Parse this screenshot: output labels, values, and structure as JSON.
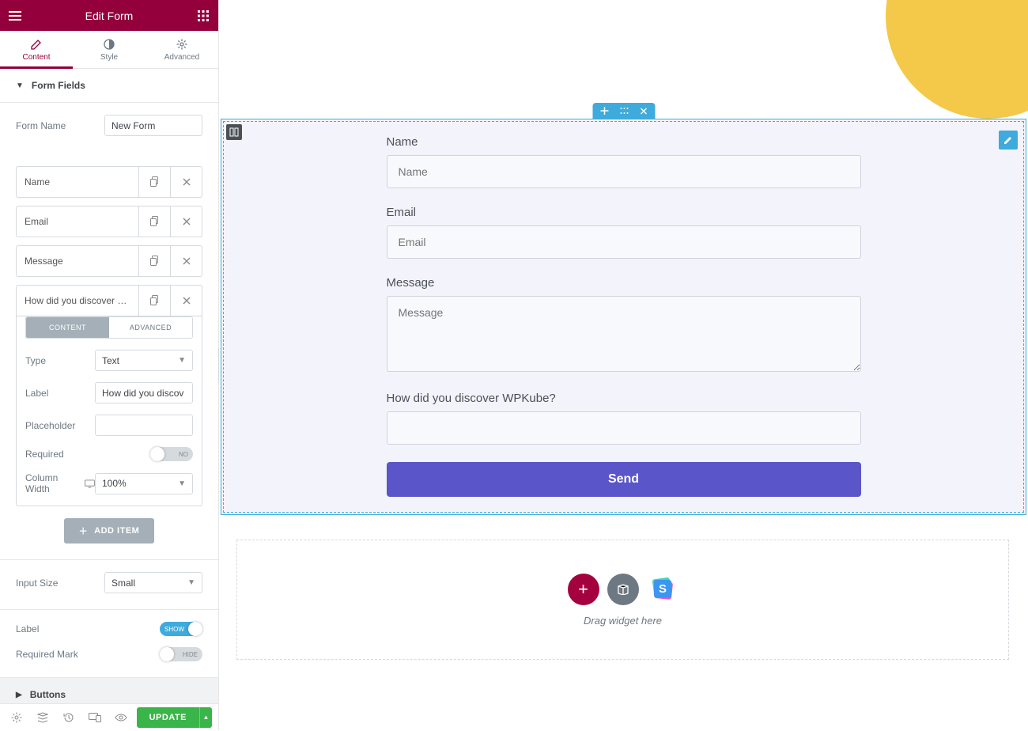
{
  "header": {
    "title": "Edit Form"
  },
  "tabs": {
    "content": "Content",
    "style": "Style",
    "advanced": "Advanced"
  },
  "sections": {
    "form_fields": "Form Fields",
    "buttons": "Buttons"
  },
  "form_name": {
    "label": "Form Name",
    "value": "New Form"
  },
  "fields": {
    "items": [
      {
        "label": "Name"
      },
      {
        "label": "Email"
      },
      {
        "label": "Message"
      },
      {
        "label": "How did you discover W…"
      }
    ],
    "subtabs": {
      "content": "CONTENT",
      "advanced": "ADVANCED"
    },
    "type": {
      "label": "Type",
      "value": "Text"
    },
    "fld_label": {
      "label": "Label",
      "value": "How did you discov"
    },
    "placeholder": {
      "label": "Placeholder",
      "value": ""
    },
    "required": {
      "label": "Required",
      "state": "NO"
    },
    "col_width": {
      "label": "Column Width",
      "value": "100%"
    },
    "add_item": "ADD ITEM"
  },
  "input_size": {
    "label": "Input Size",
    "value": "Small"
  },
  "label_toggle": {
    "label": "Label",
    "state": "SHOW"
  },
  "required_mark": {
    "label": "Required Mark",
    "state": "HIDE"
  },
  "footer": {
    "update": "UPDATE"
  },
  "canvas": {
    "form": {
      "name": {
        "label": "Name",
        "placeholder": "Name"
      },
      "email": {
        "label": "Email",
        "placeholder": "Email"
      },
      "message": {
        "label": "Message",
        "placeholder": "Message"
      },
      "discover": {
        "label": "How did you discover WPKube?",
        "placeholder": ""
      },
      "submit": "Send"
    },
    "drop": "Drag widget here"
  }
}
